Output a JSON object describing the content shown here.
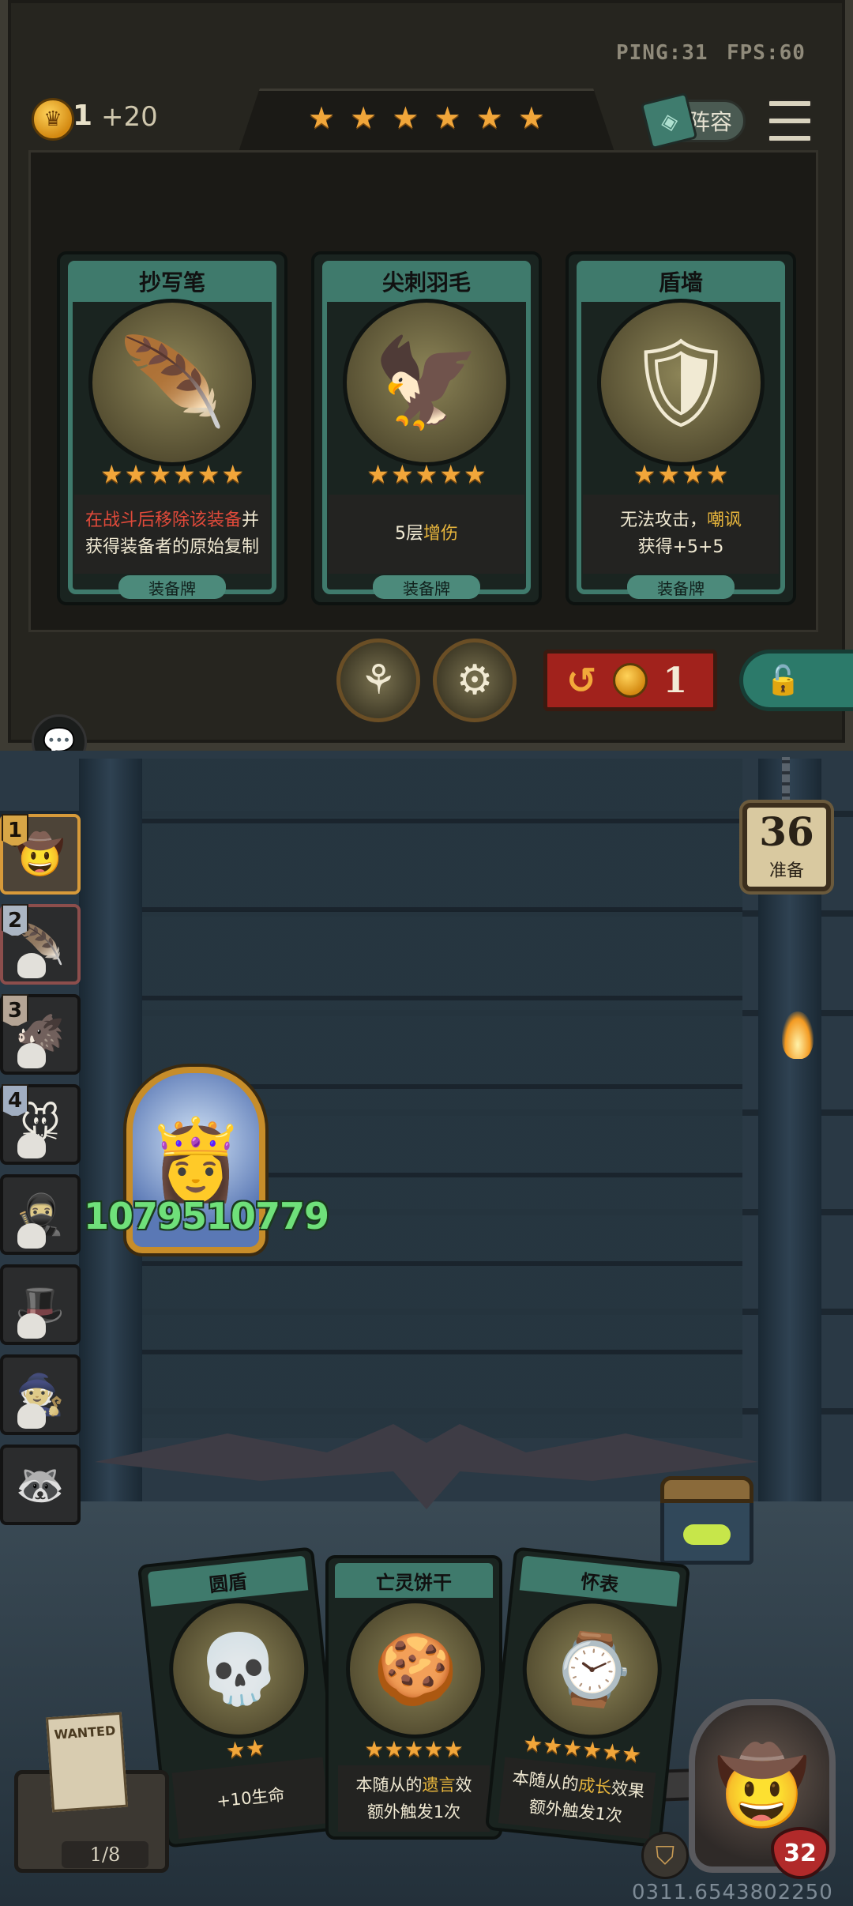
{
  "hud": {
    "ping": "PING:31",
    "fps": "FPS:60",
    "gold": "1",
    "gold_income": "+20",
    "lineup_label": "阵容",
    "shop_stars": [
      "★",
      "★",
      "★",
      "★",
      "★",
      "★"
    ]
  },
  "shop_cards": [
    {
      "name": "抄写笔",
      "icon": "quill-pen",
      "stars": [
        "★",
        "★",
        "★",
        "★",
        "★",
        "★"
      ],
      "desc_red": "在战斗后移除该装备",
      "desc_white1": "并",
      "desc_line2": "获得装备者的原始复制",
      "tag": "装备牌"
    },
    {
      "name": "尖刺羽毛",
      "icon": "spike-feather",
      "stars": [
        "★",
        "★",
        "★",
        "★",
        "★"
      ],
      "desc_prefix": "5层",
      "desc_gold": "增伤",
      "tag": "装备牌"
    },
    {
      "name": "盾墙",
      "icon": "shield-wall",
      "stars": [
        "★",
        "★",
        "★",
        "★"
      ],
      "desc_white": "无法攻击，",
      "desc_gold": "嘲讽",
      "desc_line2": "获得+5+5",
      "tag": "装备牌"
    }
  ],
  "reroll": {
    "cost": "1"
  },
  "prep": {
    "count": "36",
    "label": "准备"
  },
  "players": [
    {
      "rank": "1",
      "state": "first"
    },
    {
      "rank": "2",
      "state": "hit"
    },
    {
      "rank": "3",
      "state": "dead"
    },
    {
      "rank": "4",
      "state": "dead"
    },
    {
      "rank": "",
      "state": "dead"
    },
    {
      "rank": "",
      "state": "dead"
    },
    {
      "rank": "",
      "state": "dead"
    },
    {
      "rank": "",
      "state": "dead"
    }
  ],
  "hero": {
    "stats": "1079510779"
  },
  "hand_cards": [
    {
      "name": "圆盾",
      "icon": "round-shield",
      "stars": [
        "★",
        "★"
      ],
      "line1": "+10生命",
      "line2": ""
    },
    {
      "name": "亡灵饼干",
      "icon": "undead-biscuit",
      "stars": [
        "★",
        "★",
        "★",
        "★",
        "★"
      ],
      "line1a": "本随从的",
      "line1b": "遗言",
      "line1c": "效",
      "line2": "额外触发1次"
    },
    {
      "name": "怀表",
      "icon": "pocket-watch",
      "stars": [
        "★",
        "★",
        "★",
        "★",
        "★",
        "★"
      ],
      "line1a": "本随从的",
      "line1b": "成长",
      "line1c": "效果",
      "line2": "额外触发1次"
    }
  ],
  "wanted": {
    "poster": "WANTED",
    "progress": "1/8"
  },
  "self": {
    "hp": "32"
  },
  "build_id": "0311.6543802250"
}
